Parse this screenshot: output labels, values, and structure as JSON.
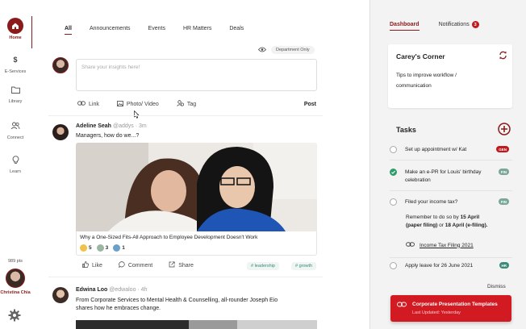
{
  "nav": {
    "items": [
      {
        "label": "Home",
        "icon": "home-icon"
      },
      {
        "label": "E-Services",
        "icon": "dollar-icon"
      },
      {
        "label": "Library",
        "icon": "folder-icon"
      },
      {
        "label": "Connect",
        "icon": "people-icon"
      },
      {
        "label": "Learn",
        "icon": "lightbulb-icon"
      }
    ],
    "points": "989 pts",
    "user_name": "Christina Chia",
    "settings_icon": "gear-icon"
  },
  "feed": {
    "tabs": [
      "All",
      "Announcements",
      "Events",
      "HR Matters",
      "Deals"
    ],
    "active_tab": "All",
    "visibility": "Department Only",
    "composer_placeholder": "Share your insights here!",
    "composer_actions": [
      "Link",
      "Photo/ Video",
      "Tag"
    ],
    "post_button": "Post",
    "posts": [
      {
        "author": "Adeline Seah",
        "handle": "@addys · 3m",
        "text": "Managers, how do we...?",
        "link_title": "Why a One-Sized Fits-All Approach to Employee Development Doesn't Work",
        "reactions": [
          "5",
          "3",
          "1"
        ],
        "actions": [
          "Like",
          "Comment",
          "Share"
        ],
        "tags": [
          "# leadership",
          "# growth"
        ]
      },
      {
        "author": "Edwina Loo",
        "handle": "@edwaloo · 4h",
        "text": "From Corporate Services to Mental Health & Counselling, all-rounder Joseph Eio shares how he embraces change."
      }
    ]
  },
  "right": {
    "tabs": [
      "Dashboard",
      "Notifications"
    ],
    "notification_count": "3",
    "card": {
      "title": "Carey's Corner",
      "text": "Tips to improve workflow / communication"
    },
    "tasks_title": "Tasks",
    "tasks": [
      {
        "text": "Set up appointment w/ Kat",
        "tag": "GEN",
        "done": false
      },
      {
        "text": "Make an e-PR for Louis' birthday celebration",
        "tag": "FIN",
        "done": true
      },
      {
        "text": "Filed your income tax?",
        "tag": "FIN",
        "done": false
      },
      {
        "text": "Apply leave for 26 June 2021",
        "tag": "HR",
        "done": false
      }
    ],
    "reminder": {
      "prefix": "Remember to do so by ",
      "date1": "15 April (paper filing)",
      "mid": " or ",
      "date2": "18 April (e-filing).",
      "link": "Income Tax Filing 2021"
    },
    "tag_colors": {
      "GEN": "#c0191e",
      "FIN": "#7aa79a",
      "HR": "#3a8b7a"
    },
    "dismiss": "Dismiss",
    "toast": {
      "title": "Corporate Presentation Templates",
      "subtitle": "Last Updated: Yesterday"
    }
  }
}
